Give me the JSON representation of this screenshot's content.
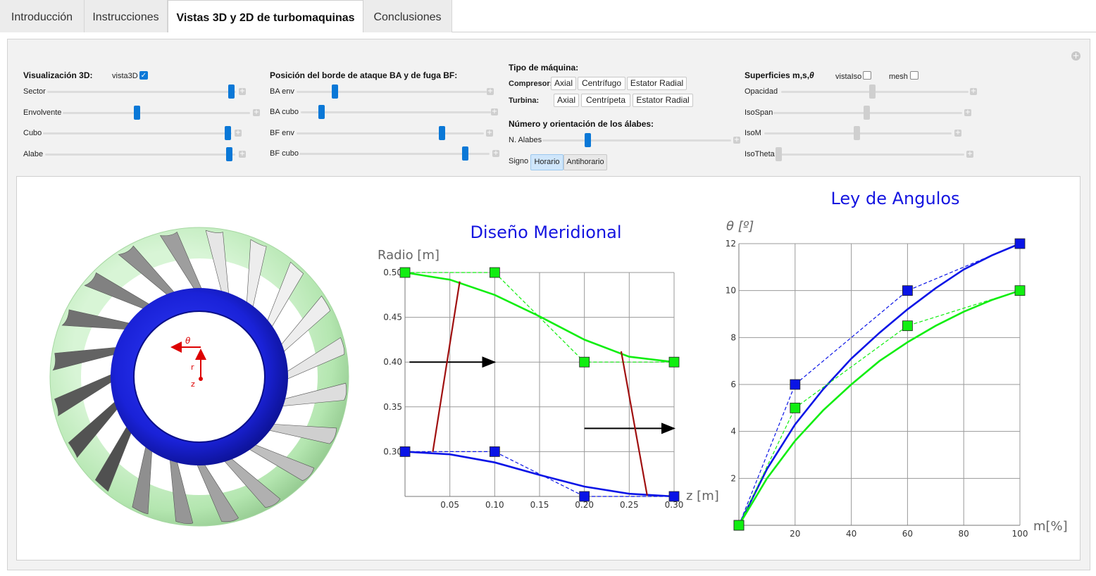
{
  "tabs": [
    "Introducción",
    "Instrucciones",
    "Vistas 3D y 2D de turbomaquinas",
    "Conclusiones"
  ],
  "vis3d": {
    "title": "Visualización 3D:",
    "checkbox_label": "vista3D",
    "checked": true,
    "sliders": [
      {
        "label": "Sector",
        "value": 0.96
      },
      {
        "label": "Envolvente",
        "value": 0.38
      },
      {
        "label": "Cubo",
        "value": 0.96
      },
      {
        "label": "Alabe",
        "value": 0.96
      }
    ]
  },
  "edges": {
    "title": "Posición del borde de ataque BA y de fuga BF:",
    "sliders": [
      {
        "label": "BA env",
        "value": 0.17
      },
      {
        "label": "BA cubo",
        "value": 0.1
      },
      {
        "label": "BF env",
        "value": 0.78
      },
      {
        "label": "BF cubo",
        "value": 0.88
      }
    ]
  },
  "machine": {
    "title": "Tipo de máquina:",
    "compresor_label": "Compresor:",
    "compresor_options": [
      "Axial",
      "Centrífugo",
      "Estator Radial"
    ],
    "turbina_label": "Turbina:",
    "turbina_options": [
      "Axial",
      "Centrípeta",
      "Estator Radial"
    ],
    "blades_title": "Número y orientación de los álabes:",
    "n_alabes_label": "N. Alabes",
    "n_alabes_value": 0.24,
    "signo_label": "Signo",
    "signo_options": [
      "Horario",
      "Antihorario"
    ],
    "signo_selected": "Horario"
  },
  "surfaces": {
    "title": "Superficies m,s,",
    "title_symbol": "θ",
    "vistaiso_label": "vistaIso",
    "mesh_label": "mesh",
    "sliders": [
      {
        "label": "Opacidad",
        "value": 0.48
      },
      {
        "label": "IsoSpan",
        "value": 0.5
      },
      {
        "label": "IsoM",
        "value": 0.48
      },
      {
        "label": "IsoTheta",
        "value": 0.0
      }
    ]
  },
  "view3d": {
    "theta_label": "θ",
    "r_label": "r",
    "z_label": "z",
    "blade_count": 20
  },
  "colors": {
    "green": "#11ee11",
    "blue": "#0a14e6",
    "red": "#a01010",
    "slider_blue": "#0a78d7",
    "title_blue": "#1515e0"
  },
  "chart_data": [
    {
      "type": "line",
      "title": "Diseño Meridional",
      "xlabel": "z [m]",
      "ylabel": "Radio [m]",
      "xlim": [
        0,
        0.3
      ],
      "ylim": [
        0.25,
        0.5
      ],
      "xticks": [
        "0.05",
        "0.10",
        "0.15",
        "0.20",
        "0.25",
        "0.30"
      ],
      "yticks": [
        "0.30",
        "0.35",
        "0.40",
        "0.45",
        "0.50"
      ],
      "grid": true,
      "series": [
        {
          "color": "green",
          "style": "solid",
          "x": [
            0,
            0.05,
            0.1,
            0.15,
            0.2,
            0.25,
            0.3
          ],
          "y": [
            0.5,
            0.492,
            0.475,
            0.451,
            0.425,
            0.406,
            0.4
          ]
        },
        {
          "color": "green",
          "style": "dashed-control",
          "x": [
            0,
            0.1,
            0.2,
            0.3
          ],
          "y": [
            0.5,
            0.5,
            0.4,
            0.4
          ]
        },
        {
          "color": "blue",
          "style": "solid",
          "x": [
            0,
            0.05,
            0.1,
            0.15,
            0.2,
            0.25,
            0.3
          ],
          "y": [
            0.3,
            0.297,
            0.288,
            0.274,
            0.261,
            0.253,
            0.25
          ]
        },
        {
          "color": "blue",
          "style": "dashed-control",
          "x": [
            0,
            0.1,
            0.2,
            0.3
          ],
          "y": [
            0.3,
            0.3,
            0.25,
            0.25
          ]
        },
        {
          "color": "red",
          "style": "solid",
          "x": [
            0.031,
            0.061
          ],
          "y": [
            0.3,
            0.49
          ]
        },
        {
          "color": "red",
          "style": "solid",
          "x": [
            0.241,
            0.27
          ],
          "y": [
            0.412,
            0.251
          ]
        }
      ],
      "arrows": [
        {
          "x": [
            0.005,
            0.1
          ],
          "y": [
            0.4,
            0.4
          ]
        },
        {
          "x": [
            0.2,
            0.3
          ],
          "y": [
            0.326,
            0.326
          ]
        }
      ]
    },
    {
      "type": "line",
      "title": "Ley de Angulos",
      "xlabel": "m[%]",
      "ylabel": "θ [º]",
      "xlim": [
        0,
        100
      ],
      "ylim": [
        0,
        12
      ],
      "xticks": [
        "20",
        "40",
        "60",
        "80",
        "100"
      ],
      "yticks": [
        "2",
        "4",
        "6",
        "8",
        "10",
        "12"
      ],
      "grid": true,
      "series": [
        {
          "color": "blue",
          "style": "solid",
          "x": [
            0,
            10,
            20,
            30,
            40,
            50,
            60,
            70,
            80,
            90,
            100
          ],
          "y": [
            0,
            2.4,
            4.3,
            5.8,
            7.1,
            8.2,
            9.2,
            10.1,
            10.9,
            11.5,
            12
          ]
        },
        {
          "color": "blue",
          "style": "dashed-control",
          "x": [
            0,
            20,
            60,
            100
          ],
          "y": [
            0,
            6,
            10,
            12
          ]
        },
        {
          "color": "green",
          "style": "solid",
          "x": [
            0,
            10,
            20,
            30,
            40,
            50,
            60,
            70,
            80,
            90,
            100
          ],
          "y": [
            0,
            2.0,
            3.6,
            4.9,
            6.0,
            7.0,
            7.8,
            8.5,
            9.1,
            9.6,
            10
          ]
        },
        {
          "color": "green",
          "style": "dashed-control",
          "x": [
            0,
            20,
            60,
            100
          ],
          "y": [
            0,
            5,
            8.5,
            10
          ]
        }
      ]
    }
  ]
}
